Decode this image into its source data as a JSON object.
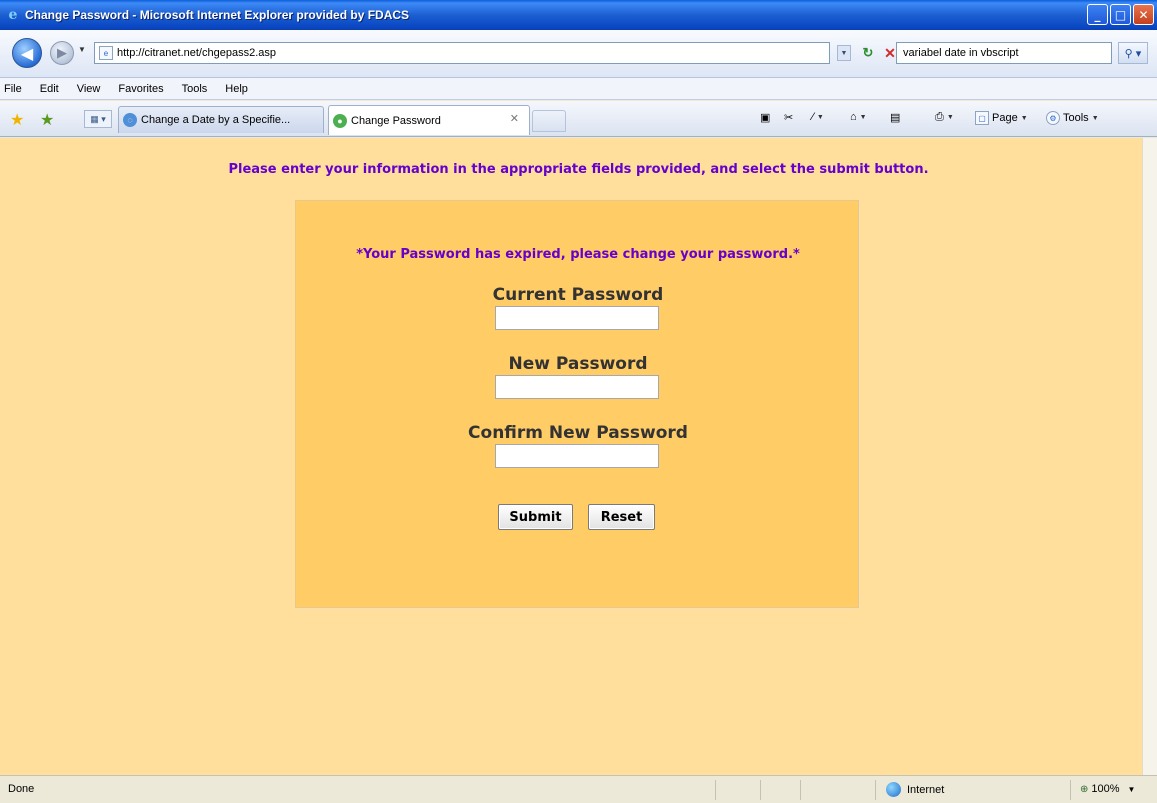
{
  "window": {
    "title": "Change Password - Microsoft Internet Explorer provided by FDACS",
    "app_icon": "ie-icon",
    "controls": [
      "minimize-icon",
      "maximize-icon",
      "close-icon"
    ]
  },
  "address_bar": {
    "url": "http://citranet.net/chgepass2.asp",
    "search_value": "variabel date in vbscript"
  },
  "menu": {
    "items": [
      "File",
      "Edit",
      "View",
      "Favorites",
      "Tools",
      "Help"
    ]
  },
  "tabs": [
    {
      "label": "Change a Date by a Specifie...",
      "active": false
    },
    {
      "label": "Change Password",
      "active": true
    }
  ],
  "command_bar": {
    "page_label": "Page",
    "tools_label": "Tools"
  },
  "page": {
    "intro": "Please enter your information in the appropriate fields provided, and select the submit button.",
    "notice": "*Your Password has expired, please change your password.*",
    "fields": [
      {
        "label": "Current Password",
        "value": ""
      },
      {
        "label": "New Password",
        "value": ""
      },
      {
        "label": "Confirm New Password",
        "value": ""
      }
    ],
    "submit_label": "Submit",
    "reset_label": "Reset",
    "colors": {
      "background": "#ffdf9b",
      "panel": "#ffcc66",
      "accent_text": "#6600cc"
    }
  },
  "status_bar": {
    "status": "Done",
    "zone": "Internet",
    "zoom": "100%"
  }
}
